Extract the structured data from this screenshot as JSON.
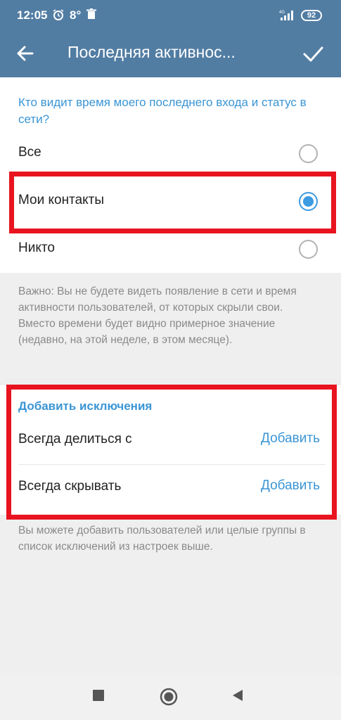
{
  "status_bar": {
    "time": "12:05",
    "temperature": "8°",
    "network": "4G",
    "battery": "92"
  },
  "app_bar": {
    "title": "Последняя активнос..."
  },
  "visibility": {
    "heading": "Кто видит время моего последнего входа и статус в сети?",
    "options": [
      {
        "label": "Все",
        "selected": false
      },
      {
        "label": "Мои контакты",
        "selected": true
      },
      {
        "label": "Никто",
        "selected": false
      }
    ],
    "note": "Важно: Вы не будете видеть появление в сети и время активности пользователей, от которых скрыли свои. Вместо времени будет видно примерное значение (недавно, на этой неделе, в этом месяце)."
  },
  "exceptions": {
    "heading": "Добавить исключения",
    "rows": [
      {
        "label": "Всегда делиться с",
        "action": "Добавить"
      },
      {
        "label": "Всегда скрывать",
        "action": "Добавить"
      }
    ],
    "note": "Вы можете добавить пользователей или целые группы в список исключений из настроек выше."
  },
  "colors": {
    "header": "#527da3",
    "accent": "#3a95d5",
    "highlight": "#e8141f"
  },
  "icons": {
    "back": "arrow-left-icon",
    "confirm": "check-icon",
    "nav_recents": "square-icon",
    "nav_home": "circle-icon",
    "nav_back": "triangle-back-icon"
  }
}
